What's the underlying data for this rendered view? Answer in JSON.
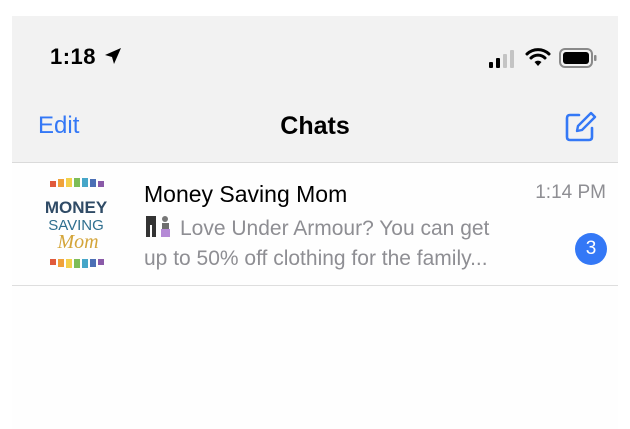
{
  "status_bar": {
    "time": "1:18",
    "icons": [
      "location-arrow-icon",
      "cellular-signal-icon",
      "wifi-icon",
      "battery-icon"
    ]
  },
  "nav": {
    "edit_label": "Edit",
    "title": "Chats",
    "compose_icon": "compose-icon"
  },
  "chats": [
    {
      "name": "Money Saving Mom",
      "time": "1:14 PM",
      "preview_line1": "Love Under Armour? You can get",
      "preview_line2": "up to 50% off clothing for the family...",
      "preview_emoji": "clothing-emoji-icon",
      "unread": "3",
      "avatar_text": [
        "MONEY",
        "SAVING",
        "Mom"
      ]
    }
  ],
  "colors": {
    "accent": "#3478f6",
    "header_bg": "#f2f2f2",
    "secondary_text": "#8e8e93"
  }
}
